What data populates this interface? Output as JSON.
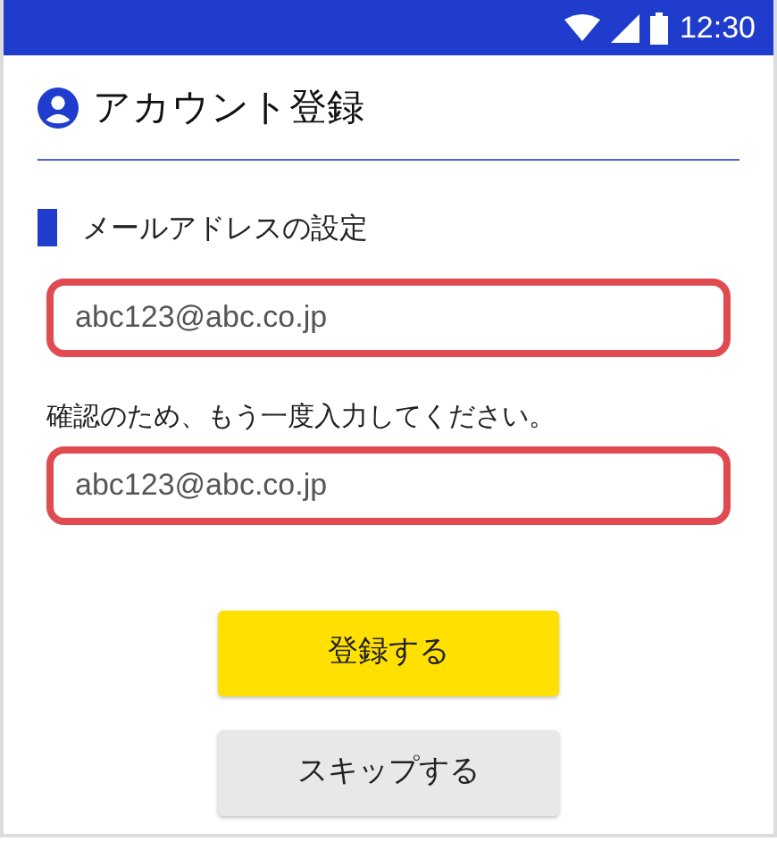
{
  "status_bar": {
    "time": "12:30"
  },
  "header": {
    "title": "アカウント登録"
  },
  "section": {
    "title": "メールアドレスの設定"
  },
  "fields": [
    {
      "kind": "input",
      "value": "abc123@abc.co.jp",
      "error": true
    },
    {
      "kind": "label",
      "text": "確認のため、もう一度入力してください。"
    },
    {
      "kind": "input",
      "value": "abc123@abc.co.jp",
      "error": true
    }
  ],
  "buttons": [
    {
      "label": "登録する",
      "kind": "primary"
    },
    {
      "label": "スキップする",
      "kind": "secondary"
    }
  ]
}
